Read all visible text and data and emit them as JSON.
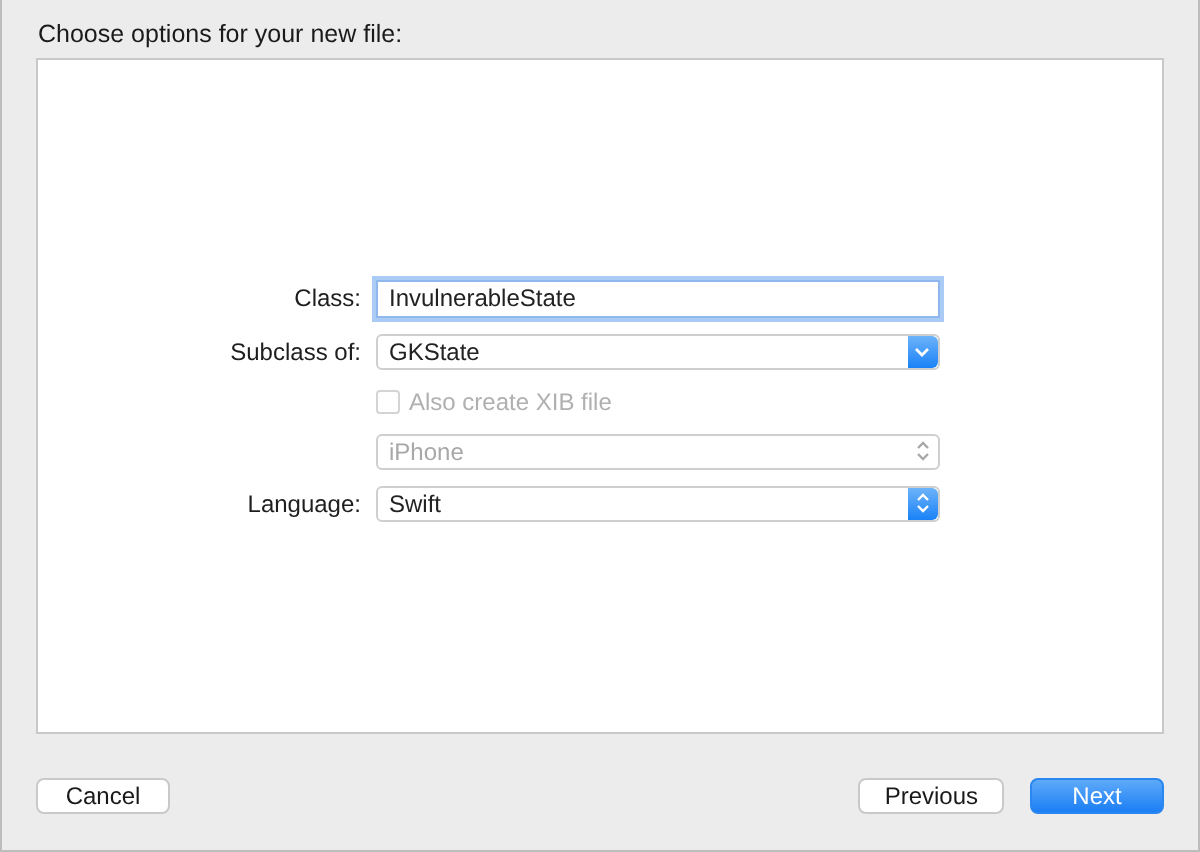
{
  "title": "Choose options for your new file:",
  "fields": [
    {
      "kind": "text",
      "label": "Class:",
      "value": "InvulnerableState",
      "focused": true
    },
    {
      "kind": "pulldown",
      "label": "Subclass of:",
      "value": "GKState",
      "disabled": false
    },
    {
      "kind": "checkbox",
      "text": "Also create XIB file",
      "checked": false,
      "disabled": true
    },
    {
      "kind": "popup",
      "value": "iPhone",
      "disabled": true
    },
    {
      "kind": "popup",
      "label": "Language:",
      "value": "Swift",
      "disabled": false
    }
  ],
  "buttons": [
    {
      "label": "Cancel",
      "default": false
    },
    {
      "label": "Previous",
      "default": false
    },
    {
      "label": "Next",
      "default": true
    }
  ]
}
